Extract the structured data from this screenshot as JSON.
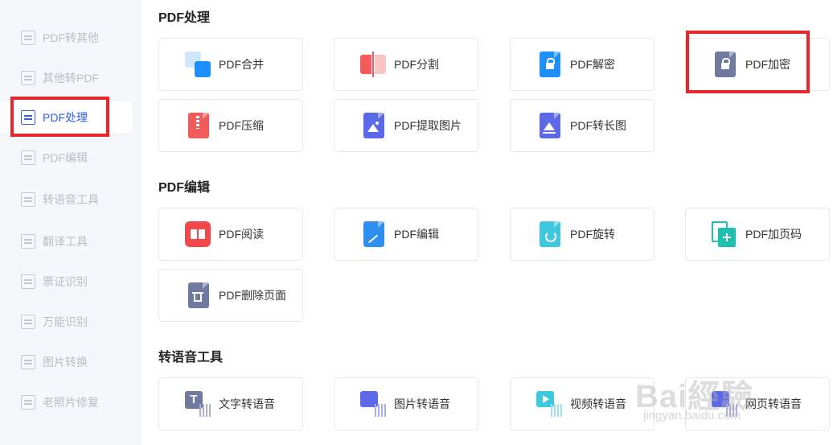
{
  "sidebar": {
    "items": [
      {
        "label": "PDF转其他",
        "icon": "pdf-convert-icon",
        "active": false
      },
      {
        "label": "其他转PDF",
        "icon": "to-pdf-icon",
        "active": false
      },
      {
        "label": "PDF处理",
        "icon": "pdf-process-icon",
        "active": true
      },
      {
        "label": "PDF编辑",
        "icon": "pdf-edit-icon",
        "active": false
      },
      {
        "label": "转语音工具",
        "icon": "voice-tool-icon",
        "active": false
      },
      {
        "label": "翻译工具",
        "icon": "translate-icon",
        "active": false
      },
      {
        "label": "票证识别",
        "icon": "ticket-icon",
        "active": false
      },
      {
        "label": "万能识别",
        "icon": "recognize-icon",
        "active": false
      },
      {
        "label": "图片转换",
        "icon": "image-convert-icon",
        "active": false
      },
      {
        "label": "老照片修复",
        "icon": "photo-repair-icon",
        "active": false
      }
    ]
  },
  "sections": [
    {
      "title": "PDF处理",
      "cards": [
        {
          "label": "PDF合并",
          "icon": "merge-icon",
          "color": "#1e8fff"
        },
        {
          "label": "PDF分割",
          "icon": "split-icon",
          "color": "#f25b5b"
        },
        {
          "label": "PDF解密",
          "icon": "unlock-icon",
          "color": "#1e8fff"
        },
        {
          "label": "PDF加密",
          "icon": "lock-icon",
          "color": "#6f7a9e"
        },
        {
          "label": "PDF压缩",
          "icon": "zip-icon",
          "color": "#f25b5b"
        },
        {
          "label": "PDF提取图片",
          "icon": "extract-image-icon",
          "color": "#5b68e8"
        },
        {
          "label": "PDF转长图",
          "icon": "long-image-icon",
          "color": "#5b68e8"
        }
      ]
    },
    {
      "title": "PDF编辑",
      "cards": [
        {
          "label": "PDF阅读",
          "icon": "book-icon",
          "color": "#f2474b"
        },
        {
          "label": "PDF编辑",
          "icon": "edit-icon",
          "color": "#2f8ff0"
        },
        {
          "label": "PDF旋转",
          "icon": "rotate-icon",
          "color": "#3ec8e0"
        },
        {
          "label": "PDF加页码",
          "icon": "add-page-icon",
          "color": "#1fc0b0"
        },
        {
          "label": "PDF删除页面",
          "icon": "delete-page-icon",
          "color": "#6f7a9e"
        }
      ]
    },
    {
      "title": "转语音工具",
      "cards": [
        {
          "label": "文字转语音",
          "icon": "text-to-speech-icon",
          "color": "#6f7a9e"
        },
        {
          "label": "图片转语音",
          "icon": "image-to-speech-icon",
          "color": "#5b68e8"
        },
        {
          "label": "视频转语音",
          "icon": "video-to-speech-icon",
          "color": "#3ec8e0"
        },
        {
          "label": "网页转语音",
          "icon": "web-to-speech-icon",
          "color": "#5b68e8"
        }
      ]
    }
  ],
  "watermark": {
    "text": "Bai經驗",
    "sub": "jingyan.baidu.com"
  }
}
